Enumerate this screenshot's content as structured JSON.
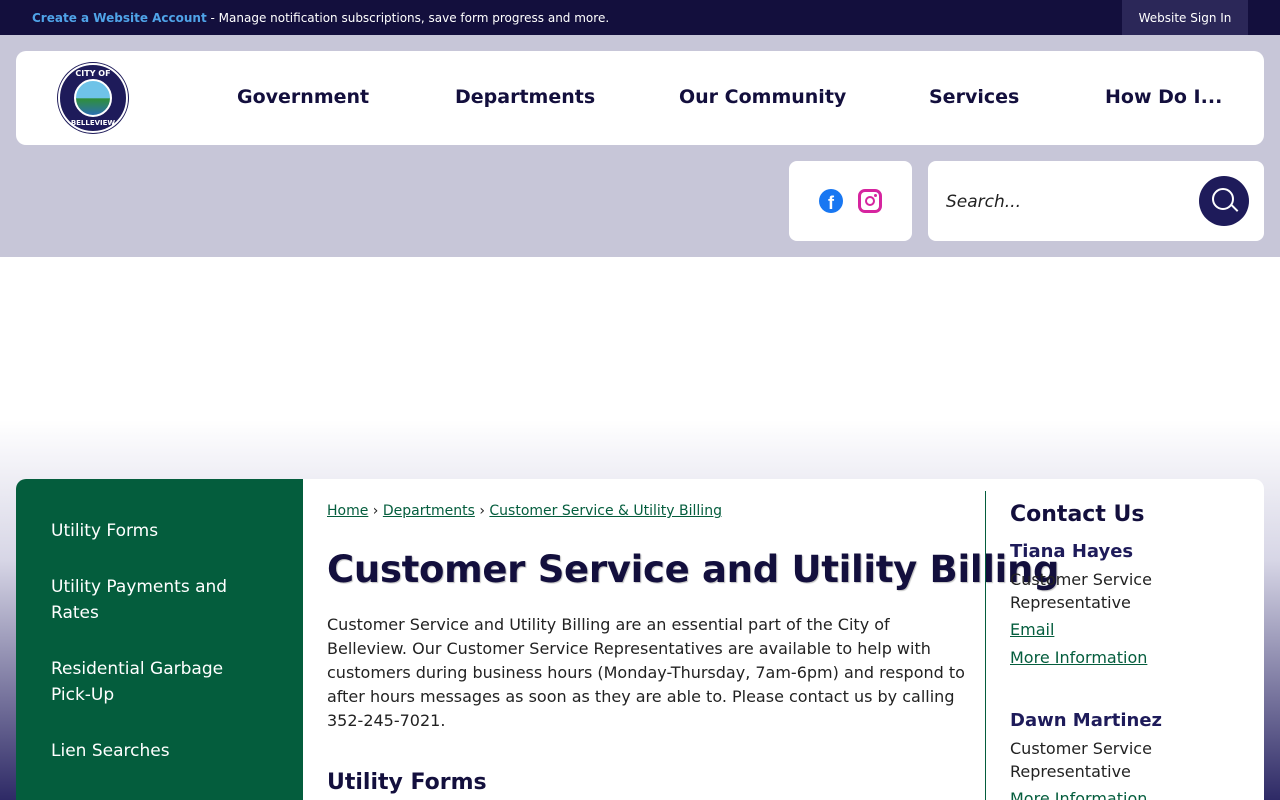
{
  "topbar": {
    "create_account_label": "Create a Website Account",
    "message": " - Manage notification subscriptions, save form progress and more.",
    "sign_in_label": "Website Sign In"
  },
  "logo": {
    "top_text": "CITY OF",
    "bottom_text": "BELLEVIEW"
  },
  "nav": {
    "items": [
      "Government",
      "Departments",
      "Our Community",
      "Services",
      "How Do I..."
    ]
  },
  "social": {
    "facebook_icon": "facebook-icon",
    "instagram_icon": "instagram-icon"
  },
  "search": {
    "placeholder": "Search...",
    "icon": "search-icon"
  },
  "sidebar": {
    "items": [
      "Utility Forms",
      "Utility Payments and Rates",
      "Residential Garbage Pick-Up",
      "Lien Searches"
    ]
  },
  "breadcrumb": {
    "items": [
      "Home",
      "Departments",
      "Customer Service & Utility Billing"
    ],
    "separator": "›"
  },
  "main": {
    "title": "Customer Service and Utility Billing",
    "intro": "Customer Service and Utility Billing are an essential part of the City of Belleview. Our Customer Service Representatives are available to help with customers during business hours (Monday-Thursday, 7am-6pm) and respond to after hours messages as soon as they are able to. Please contact us by calling 352-245-7021.",
    "section_title": "Utility Forms"
  },
  "contact": {
    "title": "Contact Us",
    "people": [
      {
        "name": "Tiana Hayes",
        "role": "Customer Service Representative",
        "email_label": "Email",
        "more_label": "More Information"
      },
      {
        "name": "Dawn Martinez",
        "role": "Customer Service Representative",
        "more_label": "More Information"
      }
    ]
  },
  "colors": {
    "navy": "#130f3d",
    "green": "#045d3d",
    "link_blue": "#4fa3e8"
  }
}
